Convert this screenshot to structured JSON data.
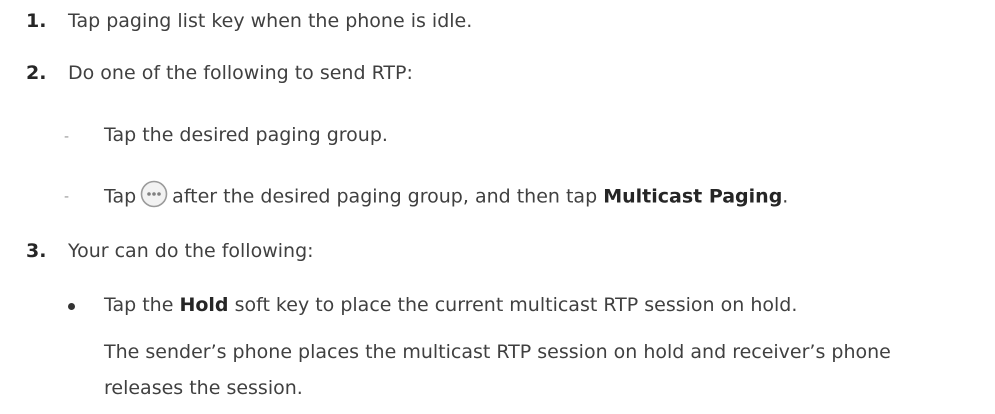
{
  "steps": [
    {
      "number": "1.",
      "text": "Tap paging list key when the phone is idle."
    },
    {
      "number": "2.",
      "text": "Do one of the following to send RTP:"
    },
    {
      "number": "3.",
      "text": "Your can do the following:"
    }
  ],
  "step2_options": {
    "dash": "-",
    "option1": "Tap the desired paging group.",
    "option2_before": "Tap",
    "option2_icon": "more-options-icon",
    "option2_middle": "after the desired paging group, and then tap",
    "option2_bold": "Multicast Paging",
    "option2_end": "."
  },
  "step3_bullet": {
    "before": "Tap the",
    "bold": "Hold",
    "after": "soft key to place the current multicast RTP session on hold.",
    "note_line1": "The sender’s phone places the multicast RTP session on hold and receiver’s phone",
    "note_line2": "releases the session."
  }
}
